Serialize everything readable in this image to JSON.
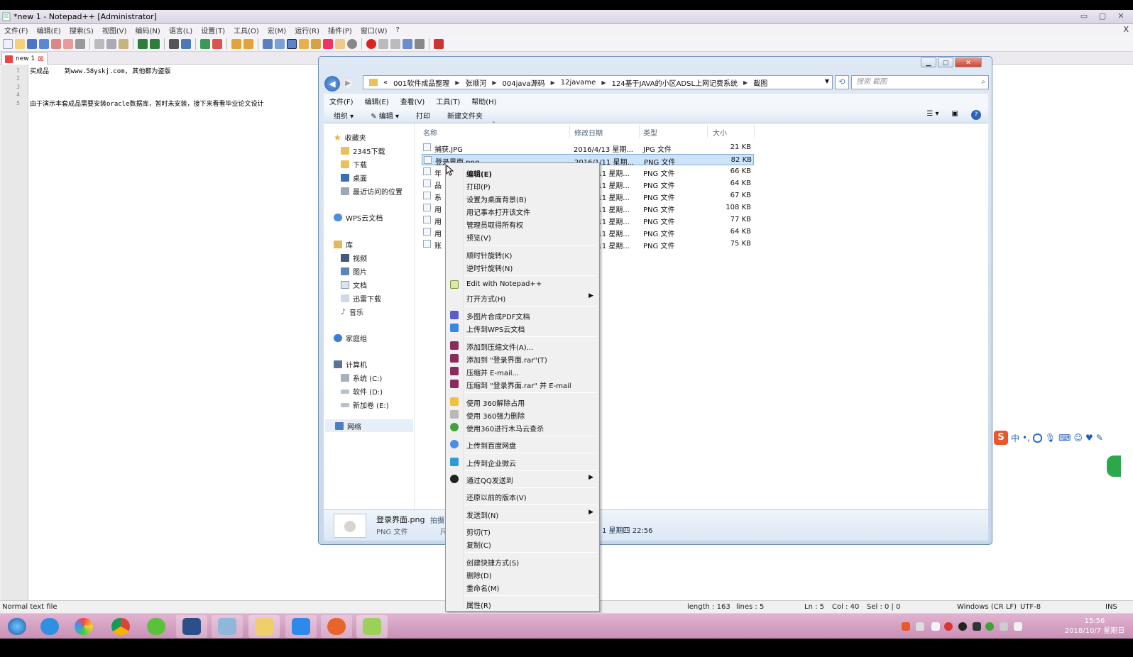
{
  "npp": {
    "title": "*new 1 - Notepad++ [Administrator]",
    "menu": [
      "文件(F)",
      "编辑(E)",
      "搜索(S)",
      "视图(V)",
      "编码(N)",
      "语言(L)",
      "设置(T)",
      "工具(O)",
      "宏(M)",
      "运行(R)",
      "插件(P)",
      "窗口(W)",
      "?"
    ],
    "close_glyph": "X",
    "tab_label": "new 1",
    "line_numbers": [
      "1",
      "2",
      "3",
      "4",
      "5"
    ],
    "lines": [
      "买成品    到www.58yskj.com, 其他都为盗版",
      "由于演示本套成品需要安装oracle数据库，暂时未安装，接下来看看毕业论文设计"
    ],
    "status": {
      "type": "Normal text file",
      "length": "length : 163",
      "lines": "lines : 5",
      "ln": "Ln : 5",
      "col": "Col : 40",
      "sel": "Sel : 0 | 0",
      "eol": "Windows (CR LF)",
      "encoding": "UTF-8",
      "mode": "INS"
    }
  },
  "explorer": {
    "breadcrumb": [
      "«",
      "001软件成品整理",
      "张顺河",
      "004java源码",
      "12javame",
      "124基于JAVA的小区ADSL上网记费系统",
      "截图"
    ],
    "search_placeholder": "搜索 截图",
    "menu": [
      "文件(F)",
      "编辑(E)",
      "查看(V)",
      "工具(T)",
      "帮助(H)"
    ],
    "commands": [
      "组织",
      "编辑",
      "打印",
      "新建文件夹"
    ],
    "nav": {
      "favorites": "收藏夹",
      "fav_items": [
        "2345下载",
        "下载",
        "桌面",
        "最近访问的位置"
      ],
      "wps": "WPS云文档",
      "library": "库",
      "lib_items": [
        "视频",
        "图片",
        "文档",
        "迅雷下载",
        "音乐"
      ],
      "homegroup": "家庭组",
      "computer": "计算机",
      "drives": [
        "系统 (C:)",
        "软件 (D:)",
        "新加卷 (E:)"
      ],
      "network": "网络"
    },
    "columns": [
      "名称",
      "修改日期",
      "类型",
      "大小"
    ],
    "files": [
      {
        "name": "捕获.JPG",
        "date": "2016/4/13 星期...",
        "type": "JPG 文件",
        "size": "21 KB"
      },
      {
        "name": "登录界面.png",
        "date": "2016/1/11 星期...",
        "type": "PNG 文件",
        "size": "82 KB"
      },
      {
        "name": "年",
        "date": "/11 星期...",
        "type": "PNG 文件",
        "size": "66 KB"
      },
      {
        "name": "品",
        "date": "/11 星期...",
        "type": "PNG 文件",
        "size": "64 KB"
      },
      {
        "name": "系",
        "date": "/11 星期...",
        "type": "PNG 文件",
        "size": "67 KB"
      },
      {
        "name": "用",
        "date": "/11 星期...",
        "type": "PNG 文件",
        "size": "108 KB"
      },
      {
        "name": "用",
        "date": "/11 星期...",
        "type": "PNG 文件",
        "size": "77 KB"
      },
      {
        "name": "用",
        "date": "/11 星期...",
        "type": "PNG 文件",
        "size": "64 KB"
      },
      {
        "name": "账",
        "date": "/11 星期...",
        "type": "PNG 文件",
        "size": "75 KB"
      }
    ],
    "details": {
      "name": "登录界面.png",
      "name_suffix": "拍摄日",
      "type": "PNG 文件",
      "type_suffix": "尺",
      "date": "1 星期四 22:56"
    }
  },
  "context_menu": {
    "groups": [
      [
        "编辑(E)",
        "打印(P)",
        "设置为桌面背景(B)",
        "用记事本打开该文件",
        "管理员取得所有权",
        "预览(V)"
      ],
      [
        "顺时针旋转(K)",
        "逆时针旋转(N)"
      ],
      [
        "Edit with Notepad++",
        "打开方式(H)"
      ],
      [
        "多图片合成PDF文档",
        "上传到WPS云文档"
      ],
      [
        "添加到压缩文件(A)...",
        "添加到 \"登录界面.rar\"(T)",
        "压缩并 E-mail...",
        "压缩到 \"登录界面.rar\" 并 E-mail"
      ],
      [
        "使用 360解除占用",
        "使用 360强力删除",
        "使用360进行木马云查杀"
      ],
      [
        "上传到百度网盘"
      ],
      [
        "上传到企业微云"
      ],
      [
        "通过QQ发送到"
      ],
      [
        "还原以前的版本(V)"
      ],
      [
        "发送到(N)"
      ],
      [
        "剪切(T)",
        "复制(C)"
      ],
      [
        "创建快捷方式(S)",
        "删除(D)",
        "重命名(M)"
      ],
      [
        "属性(R)"
      ]
    ]
  },
  "taskbar": {
    "time": "15:56",
    "date": "2018/10/7 星期日"
  },
  "ime": {
    "s": "S",
    "mode": "中"
  }
}
